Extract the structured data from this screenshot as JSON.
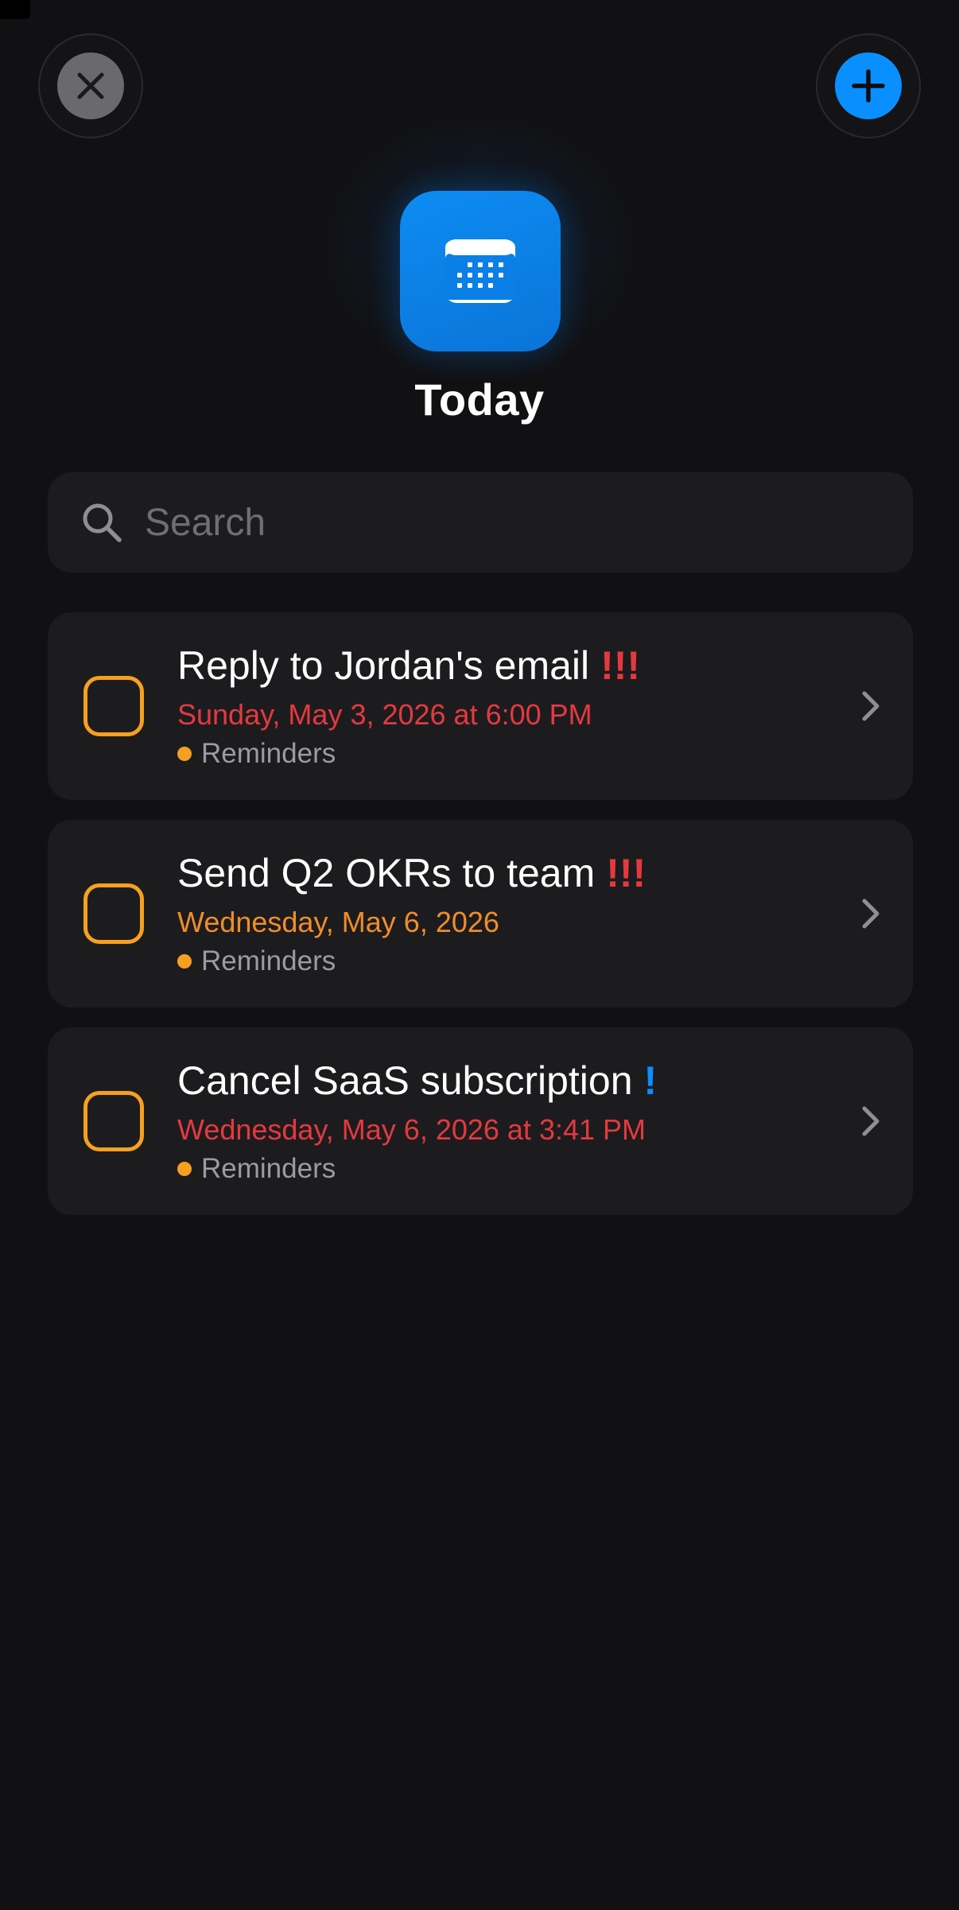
{
  "header": {
    "title": "Today",
    "close_icon": "close-icon",
    "add_icon": "plus-icon",
    "app_icon": "calendar-icon"
  },
  "search": {
    "placeholder": "Search",
    "value": ""
  },
  "reminders": [
    {
      "title": "Reply to Jordan's email",
      "priority": "!!!",
      "priority_color": "#e5393e",
      "date": "Sunday, May 3, 2026 at 6:00 PM",
      "date_color": "#e5393e",
      "list": "Reminders",
      "list_color": "#f7a020"
    },
    {
      "title": "Send Q2 OKRs to team",
      "priority": "!!!",
      "priority_color": "#e5393e",
      "date": "Wednesday, May 6, 2026",
      "date_color": "#f08d2a",
      "list": "Reminders",
      "list_color": "#f7a020"
    },
    {
      "title": "Cancel SaaS subscription",
      "priority": "!",
      "priority_color": "#0a8fff",
      "date": "Wednesday, May 6, 2026 at 3:41 PM",
      "date_color": "#e5393e",
      "list": "Reminders",
      "list_color": "#f7a020"
    }
  ],
  "colors": {
    "background": "#111113",
    "card": "#1c1c1f",
    "accent_blue": "#0a8fff",
    "checkbox_orange": "#f7a020",
    "overdue_red": "#e5393e",
    "secondary_text": "#9b9ba0"
  }
}
